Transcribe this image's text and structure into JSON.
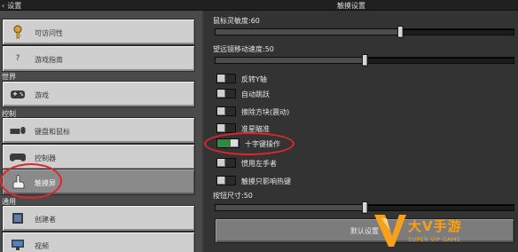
{
  "topbar": {
    "back_label": "设置",
    "title": "触摸设置"
  },
  "sidebar": {
    "items": [
      {
        "label": "可访问性",
        "icon": "key-icon"
      },
      {
        "label": "游戏指南",
        "icon": "question-icon"
      },
      {
        "label": "游戏",
        "icon": "gamepad-icon"
      },
      {
        "label": "键盘和鼠标",
        "icon": "keyboard-mouse-icon"
      },
      {
        "label": "控制器",
        "icon": "controller-icon"
      },
      {
        "label": "触摸屏",
        "icon": "touch-hand-icon",
        "selected": true
      },
      {
        "label": "创建者",
        "icon": "creator-icon"
      },
      {
        "label": "视频",
        "icon": "monitor-icon"
      }
    ],
    "sections": {
      "world": "世界",
      "controls": "控制",
      "general": "通用",
      "creator_button_hint": "?"
    }
  },
  "settings": {
    "sliders": [
      {
        "label": "鼠标灵敏度:60",
        "value": 0.6
      },
      {
        "label": "望远镜移动速度:50",
        "value": 0.5
      },
      {
        "label": "按钮尺寸:50",
        "value": 0.5
      }
    ],
    "toggles": [
      {
        "label": "反转Y轴",
        "on": false
      },
      {
        "label": "自动跳跃",
        "on": false
      },
      {
        "label": "擦除方块(震动)",
        "on": false
      },
      {
        "label": "准星瞄准",
        "on": false
      },
      {
        "label": "十字键操作",
        "on": true
      },
      {
        "label": "惯用左手者",
        "on": false
      },
      {
        "label": "触摸只影响热键",
        "on": false
      }
    ],
    "reset_label": "默认设置"
  },
  "watermark": {
    "brand": "大V手游",
    "tagline": "SUPER VIP GAME"
  },
  "colors": {
    "highlight": "#e0262b",
    "toggle_on": "#2f8a3a",
    "brand": "#f7a11a"
  }
}
